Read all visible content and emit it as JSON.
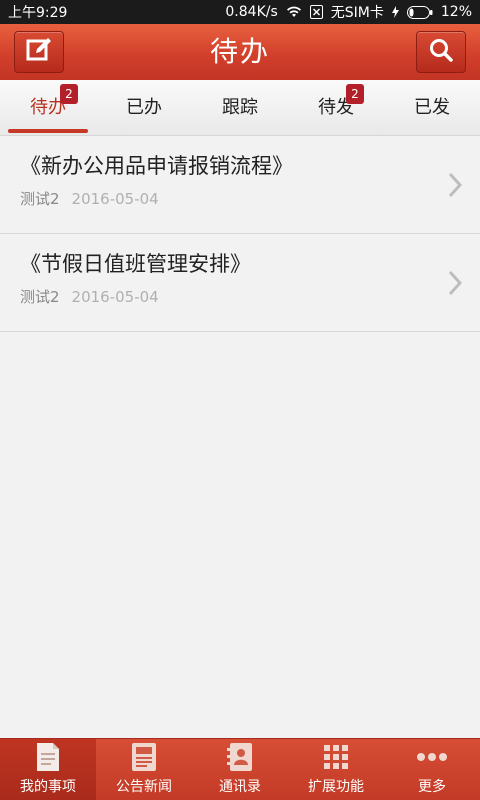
{
  "status_bar": {
    "time": "上午9:29",
    "speed": "0.84K/s",
    "sim": "无SIM卡",
    "battery": "12%"
  },
  "header": {
    "title": "待办",
    "left_icon": "compose-icon",
    "right_icon": "search-icon"
  },
  "tabs": [
    {
      "label": "待办",
      "badge": "2",
      "active": true
    },
    {
      "label": "已办",
      "badge": "",
      "active": false
    },
    {
      "label": "跟踪",
      "badge": "",
      "active": false
    },
    {
      "label": "待发",
      "badge": "2",
      "active": false
    },
    {
      "label": "已发",
      "badge": "",
      "active": false
    }
  ],
  "items": [
    {
      "title": "《新办公用品申请报销流程》",
      "author": "测试2",
      "date": "2016-05-04"
    },
    {
      "title": "《节假日值班管理安排》",
      "author": "测试2",
      "date": "2016-05-04"
    }
  ],
  "bottom_nav": [
    {
      "label": "我的事项",
      "icon": "document-icon",
      "active": true
    },
    {
      "label": "公告新闻",
      "icon": "newspaper-icon",
      "active": false
    },
    {
      "label": "通讯录",
      "icon": "contacts-icon",
      "active": false
    },
    {
      "label": "扩展功能",
      "icon": "grid-icon",
      "active": false
    },
    {
      "label": "更多",
      "icon": "more-icon",
      "active": false
    }
  ],
  "colors": {
    "brand": "#d2402b",
    "badge": "#b3202a",
    "active_tab": "#b8341f"
  }
}
